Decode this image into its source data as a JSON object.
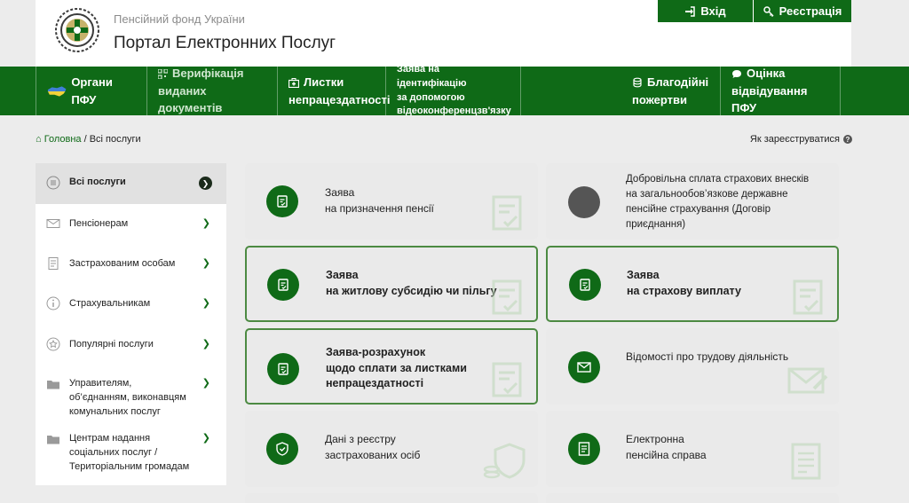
{
  "header": {
    "org_name": "Пенсійний фонд України",
    "portal_name": "Портал Електронних Послуг",
    "login_label": "Вхід",
    "register_label": "Реєстрація"
  },
  "nav": {
    "items": [
      {
        "label": "Органи ПФУ"
      },
      {
        "label_line1": "Верифікація",
        "label_line2": "виданих документів"
      },
      {
        "label_line1": "Листки",
        "label_line2": "непрацездатності"
      },
      {
        "label_line1": "Заява на ідентифікацію",
        "label_line2": "за допомогою",
        "label_line3": "відеоконференцзв'язку"
      },
      {
        "label_line1": "Благодійні",
        "label_line2": "пожертви"
      },
      {
        "label_line1": "Оцінка",
        "label_line2": "відвідування ПФУ"
      }
    ]
  },
  "breadcrumb": {
    "home": "Головна",
    "separator": "/",
    "current": "Всі послуги"
  },
  "howto": "Як зареєструватися",
  "sidebar": {
    "items": [
      {
        "label": "Всі послуги"
      },
      {
        "label": "Пенсіонерам"
      },
      {
        "label": "Застрахованим особам"
      },
      {
        "label": "Страхувальникам"
      },
      {
        "label": "Популярні послуги"
      },
      {
        "line1": "Управителям,",
        "line2": "об’єднанням, виконавцям",
        "line3": "комунальних послуг"
      },
      {
        "line1": "Центрам надання",
        "line2": "соціальних послуг /",
        "line3": "Територіальним громадам"
      }
    ]
  },
  "cards": [
    {
      "line1": "Заява",
      "line2": "на призначення пенсії"
    },
    {
      "line1": "Добровільна сплата страхових внесків",
      "line2": "на загальнообов’язкове державне",
      "line3": "пенсійне страхування (Договір",
      "line4": "приєднання)"
    },
    {
      "line1": "Заява",
      "line2": "на житлову субсидію чи пільгу"
    },
    {
      "line1": "Заява",
      "line2": "на страхову виплату"
    },
    {
      "line1": "Заява-розрахунок",
      "line2": "щодо сплати за листками",
      "line3": "непрацездатності"
    },
    {
      "line1": "Відомості про трудову діяльність"
    },
    {
      "line1": "Дані з реєстру",
      "line2": "застрахованих осіб"
    },
    {
      "line1": "Електронна",
      "line2": "пенсійна справа"
    }
  ],
  "colors": {
    "brand_green": "#0f6a17",
    "card_bg": "#eaeaea",
    "card_border": "#4c8a42",
    "page_bg": "#ececec"
  }
}
